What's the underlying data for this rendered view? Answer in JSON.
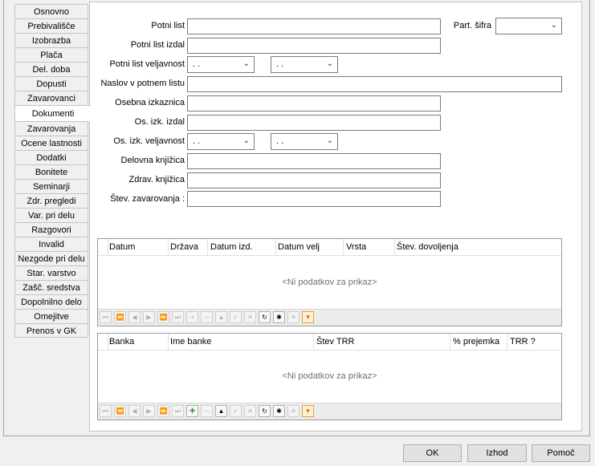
{
  "tabs": [
    "Osnovno",
    "Prebivališče",
    "Izobrazba",
    "Plača",
    "Del. doba",
    "Dopusti",
    "Zavarovanci",
    "Dokumenti",
    "Zavarovanja",
    "Ocene lastnosti",
    "Dodatki",
    "Bonitete",
    "Seminarji",
    "Zdr. pregledi",
    "Var. pri delu",
    "Razgovori",
    "Invalid",
    "Nezgode pri delu",
    "Star. varstvo",
    "Zašč. sredstva",
    "Dopolnilno delo",
    "Omejitve",
    "Prenos v GK"
  ],
  "active_tab": "Dokumenti",
  "form": {
    "potni_list": {
      "label": "Potni list",
      "value": ""
    },
    "part_sifra": {
      "label": "Part. šifra",
      "value": ""
    },
    "potni_list_izdal": {
      "label": "Potni list izdal",
      "value": ""
    },
    "potni_list_veljavnost": {
      "label": "Potni list veljavnost",
      "from": " .  .",
      "to": " .  ."
    },
    "naslov": {
      "label": "Naslov v potnem listu",
      "value": ""
    },
    "osebna": {
      "label": "Osebna izkaznica",
      "value": ""
    },
    "os_izdal": {
      "label": "Os. izk. izdal",
      "value": ""
    },
    "os_veljavnost": {
      "label": "Os. izk. veljavnost",
      "from": " .  .",
      "to": " .  ."
    },
    "delovna": {
      "label": "Delovna knjižica",
      "value": ""
    },
    "zdrav": {
      "label": "Zdrav. knjižica",
      "value": ""
    },
    "stev_zav": {
      "label": "Štev. zavarovanja :",
      "value": ""
    }
  },
  "grid1": {
    "columns": [
      "Datum",
      "Država",
      "Datum izd.",
      "Datum velj",
      "Vrsta",
      "Štev. dovoljenja"
    ],
    "empty": "<Ni podatkov za prikaz>"
  },
  "grid2": {
    "columns": [
      "Banka",
      "Ime banke",
      "Štev TRR",
      "% prejemka",
      "TRR ?"
    ],
    "empty": "<Ni podatkov za prikaz>"
  },
  "buttons": {
    "ok": "OK",
    "izhod": "Izhod",
    "pomoc": "Pomoč"
  }
}
